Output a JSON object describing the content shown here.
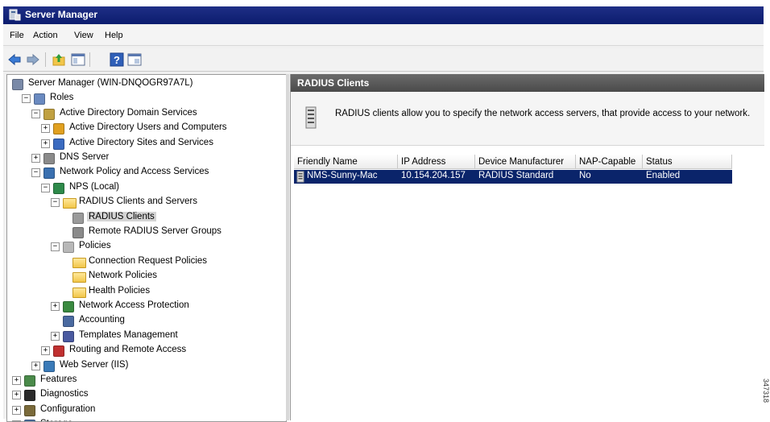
{
  "window": {
    "title": "Server Manager"
  },
  "menu": [
    "File",
    "Action",
    "View",
    "Help"
  ],
  "toolbar": [
    "back-icon",
    "forward-icon",
    "up-icon",
    "show-hide-console-tree-icon",
    "help-icon",
    "properties-icon"
  ],
  "tree": [
    {
      "label": "Server Manager (WIN-DNQOGR97A7L)",
      "expander": "",
      "icon": "server-icon"
    },
    {
      "label": "Roles",
      "expander": "−",
      "icon": "roles-icon"
    },
    {
      "label": "Active Directory Domain Services",
      "expander": "−",
      "icon": "ad-domain-icon"
    },
    {
      "label": "Active Directory Users and Computers",
      "expander": "+",
      "icon": "ad-users-icon"
    },
    {
      "label": "Active Directory Sites and Services",
      "expander": "+",
      "icon": "ad-sites-icon"
    },
    {
      "label": "DNS Server",
      "expander": "+",
      "icon": "dns-icon"
    },
    {
      "label": "Network Policy and Access Services",
      "expander": "−",
      "icon": "npas-icon"
    },
    {
      "label": "NPS (Local)",
      "expander": "−",
      "icon": "nps-icon"
    },
    {
      "label": "RADIUS Clients and Servers",
      "expander": "−",
      "icon": "folder-icon"
    },
    {
      "label": "RADIUS Clients",
      "expander": "",
      "icon": "radius-client-icon"
    },
    {
      "label": "Remote RADIUS Server Groups",
      "expander": "",
      "icon": "server-group-icon"
    },
    {
      "label": "Policies",
      "expander": "−",
      "icon": "policies-icon"
    },
    {
      "label": "Connection Request Policies",
      "expander": "",
      "icon": "folder-icon"
    },
    {
      "label": "Network Policies",
      "expander": "",
      "icon": "folder-icon"
    },
    {
      "label": "Health Policies",
      "expander": "",
      "icon": "folder-icon"
    },
    {
      "label": "Network Access Protection",
      "expander": "+",
      "icon": "nap-icon"
    },
    {
      "label": "Accounting",
      "expander": "",
      "icon": "accounting-icon"
    },
    {
      "label": "Templates Management",
      "expander": "+",
      "icon": "templates-icon"
    },
    {
      "label": "Routing and Remote Access",
      "expander": "+",
      "icon": "routing-icon"
    },
    {
      "label": "Web Server (IIS)",
      "expander": "+",
      "icon": "iis-icon"
    },
    {
      "label": "Features",
      "expander": "+",
      "icon": "features-icon"
    },
    {
      "label": "Diagnostics",
      "expander": "+",
      "icon": "diagnostics-icon"
    },
    {
      "label": "Configuration",
      "expander": "+",
      "icon": "configuration-icon"
    },
    {
      "label": "Storage",
      "expander": "+",
      "icon": "storage-icon"
    }
  ],
  "selected_node": "RADIUS Clients",
  "pane": {
    "title": "RADIUS Clients",
    "description": "RADIUS clients allow you to specify the network access servers, that provide access to your network."
  },
  "list": {
    "columns": [
      "Friendly Name",
      "IP Address",
      "Device Manufacturer",
      "NAP-Capable",
      "Status"
    ],
    "rows": [
      [
        "NMS-Sunny-Mac",
        "10.154.204.157",
        "RADIUS Standard",
        "No",
        "Enabled"
      ]
    ]
  },
  "figure_id": "347318",
  "colors": {
    "title_bar": "#0b1c6e",
    "selection": "#0a246a",
    "pane_header": "#555555"
  }
}
